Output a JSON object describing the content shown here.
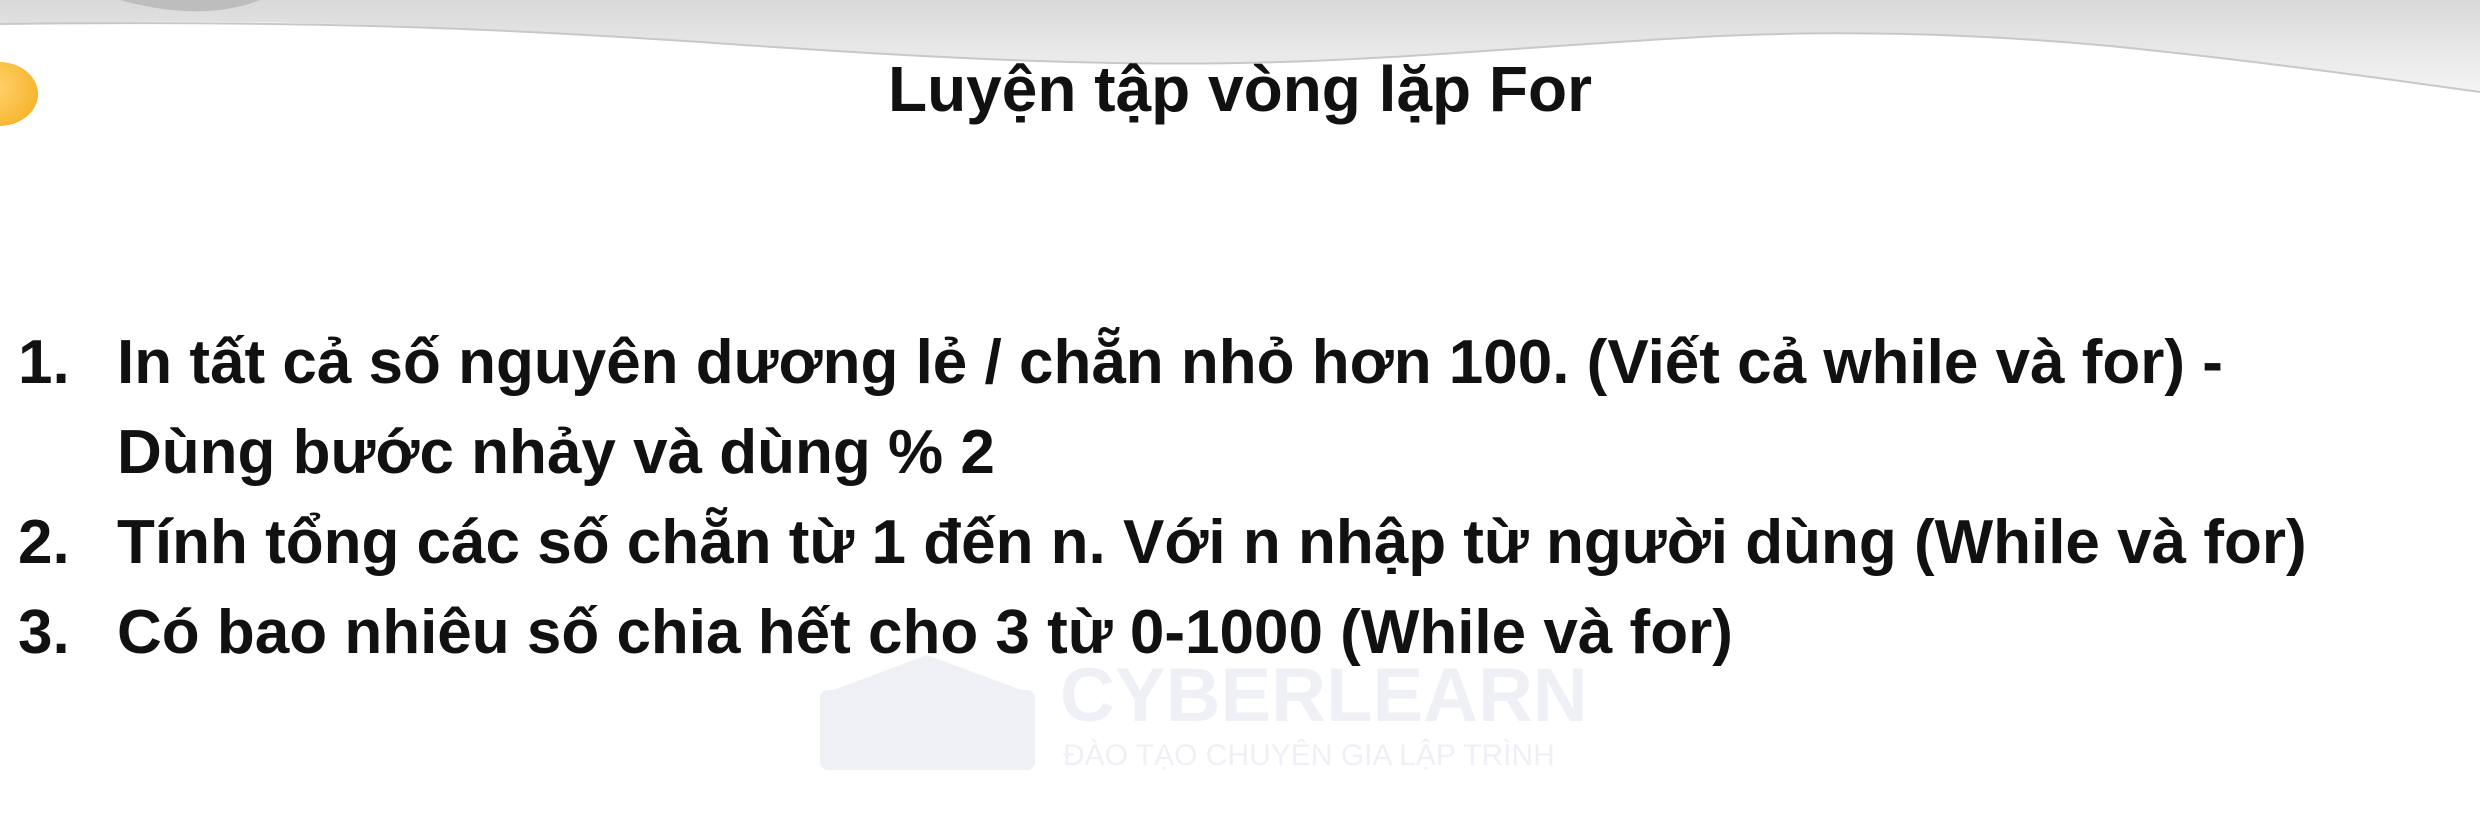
{
  "slide": {
    "title": "Luyện tập vòng lặp For",
    "tasks": [
      {
        "number": "1.",
        "lines": [
          "In tất cả số nguyên dương lẻ / chẵn nhỏ hơn 100. (Viết cả while và for) -",
          "Dùng bước nhảy và dùng % 2"
        ]
      },
      {
        "number": "2.",
        "lines": [
          "Tính tổng các số chẵn từ 1 đến n. Với n nhập từ người dùng (While và for)"
        ]
      },
      {
        "number": "3.",
        "lines": [
          "Có bao nhiêu số chia hết cho 3 từ 0-1000 (While và for)"
        ]
      }
    ]
  },
  "watermark": {
    "name": "CYBERLEARN",
    "tagline": "ĐÀO TẠO CHUYÊN GIA LẬP TRÌNH"
  },
  "colors": {
    "text": "#111111",
    "accent_dot": "#f7b733",
    "watermark": "#1e3a8a"
  }
}
